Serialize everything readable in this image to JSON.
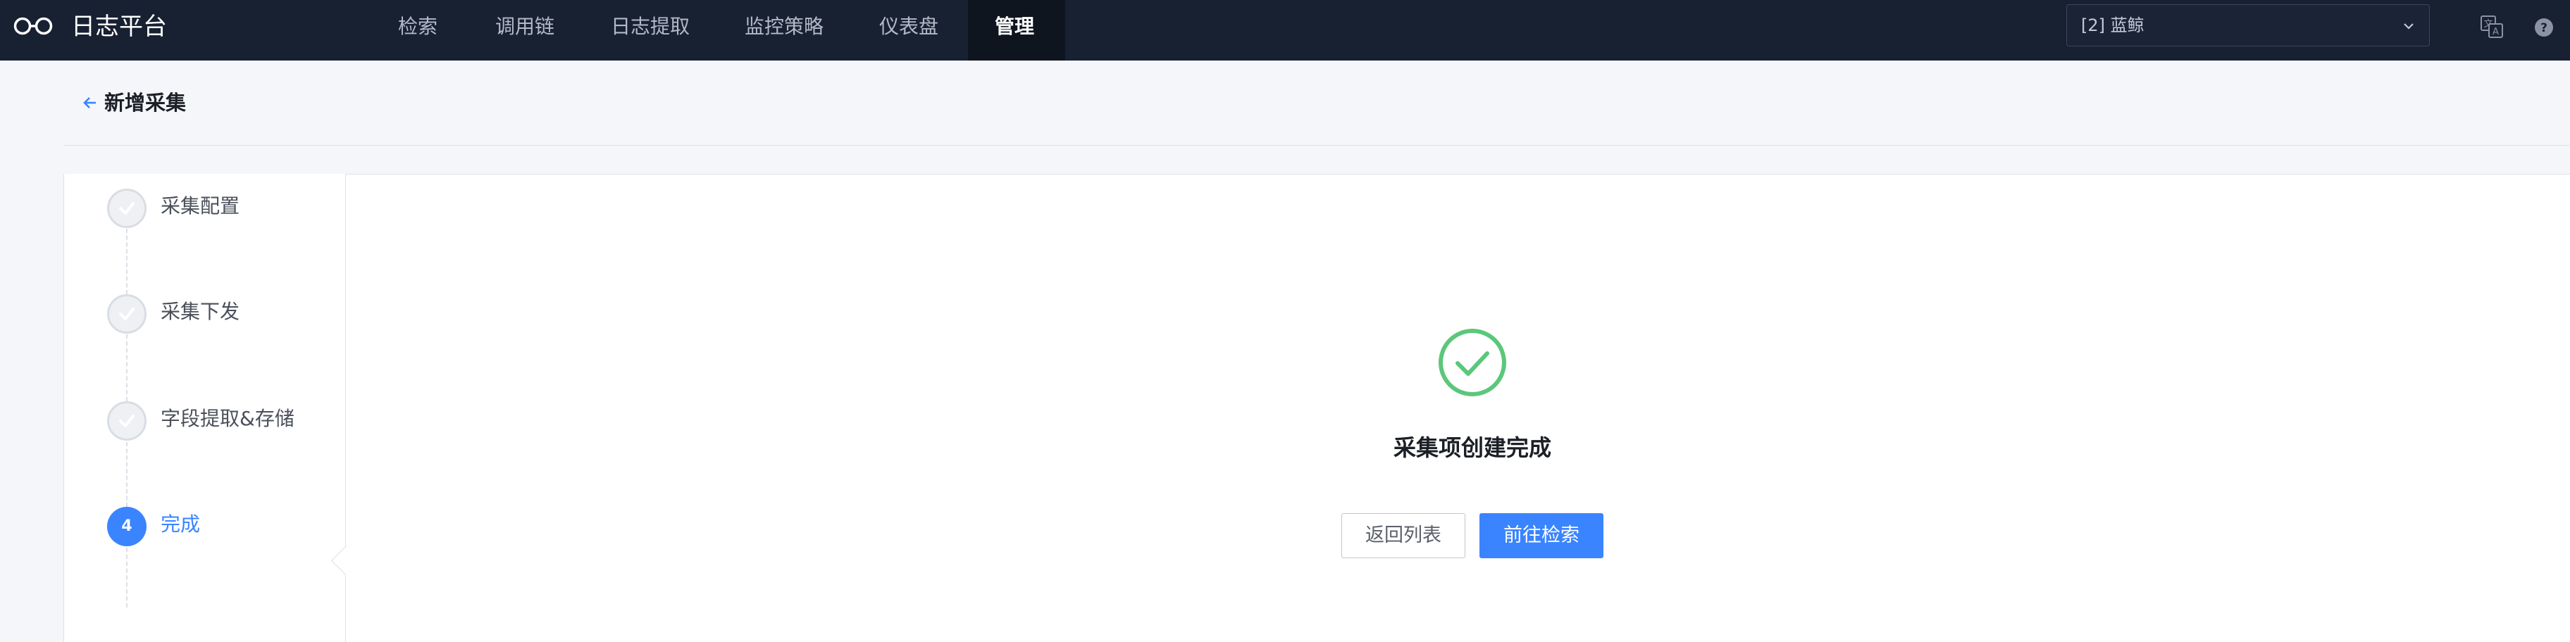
{
  "app": {
    "title": "日志平台",
    "logo_icon": "infinity-logo-icon"
  },
  "nav": {
    "items": [
      {
        "label": "检索"
      },
      {
        "label": "调用链"
      },
      {
        "label": "日志提取"
      },
      {
        "label": "监控策略"
      },
      {
        "label": "仪表盘"
      },
      {
        "label": "管理",
        "active": true
      }
    ]
  },
  "header_right": {
    "business_select": "[2] 蓝鲸",
    "icons": [
      "translate-icon",
      "help-icon"
    ]
  },
  "page": {
    "back_icon": "arrow-left-icon",
    "title": "新增采集"
  },
  "steps": [
    {
      "label": "采集配置",
      "status": "done"
    },
    {
      "label": "采集下发",
      "status": "done"
    },
    {
      "label": "字段提取&存储",
      "status": "done"
    },
    {
      "label": "完成",
      "number": "4",
      "status": "current"
    }
  ],
  "result": {
    "icon": "success-check-icon",
    "message": "采集项创建完成",
    "back_button": "返回列表",
    "search_button": "前往检索"
  },
  "colors": {
    "topbar": "#182132",
    "primary": "#3a84ff",
    "success": "#5bc77a"
  }
}
